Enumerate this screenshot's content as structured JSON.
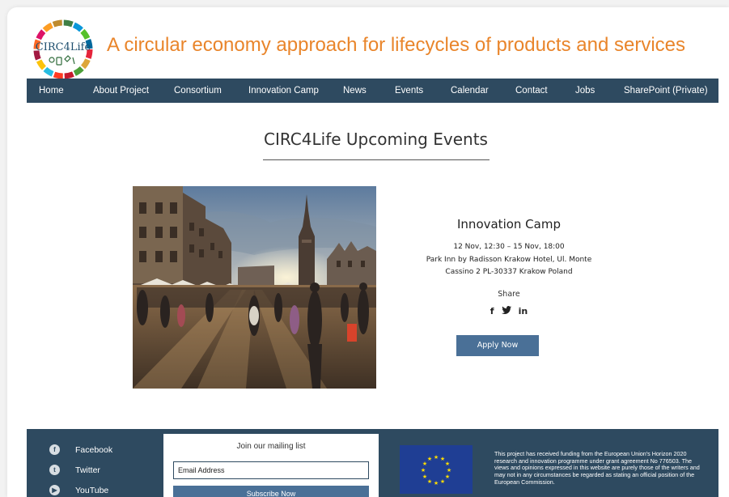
{
  "header": {
    "logo_text": "CIRC4Life",
    "tagline": "A circular economy approach for lifecycles of products and services"
  },
  "nav": {
    "items": [
      "Home",
      "About Project",
      "Consortium",
      "Innovation Camp",
      "News",
      "Events",
      "Calendar",
      "Contact",
      "Jobs",
      "SharePoint (Private)"
    ]
  },
  "main": {
    "title": "CIRC4Life Upcoming Events",
    "event": {
      "title": "Innovation Camp",
      "date": "12 Nov, 12:30 – 15 Nov, 18:00",
      "location_line1": "Park Inn by Radisson Krakow Hotel, Ul. Monte",
      "location_line2": "Cassino 2 PL-30337 Krakow Poland",
      "share_label": "Share",
      "share_icons": [
        "facebook-icon",
        "twitter-icon",
        "linkedin-icon"
      ],
      "apply_label": "Apply Now"
    }
  },
  "footer": {
    "social": [
      {
        "label": "Facebook",
        "icon": "facebook-icon"
      },
      {
        "label": "Twitter",
        "icon": "twitter-icon"
      },
      {
        "label": "YouTube",
        "icon": "youtube-icon"
      }
    ],
    "mailing": {
      "title": "Join our mailing list",
      "placeholder": "Email Address",
      "button": "Subscribe Now"
    },
    "disclaimer": "This project has received funding from the European Union's Horizon 2020 research and innovation programme under grant agreement No 776503. The views and opinions expressed in this website are purely those of the writers and may not in any circumstances be regarded as stating an official position of the European Commission."
  },
  "colors": {
    "nav_bg": "#2e4a60",
    "tagline": "#e9852b",
    "button": "#4a7097"
  }
}
